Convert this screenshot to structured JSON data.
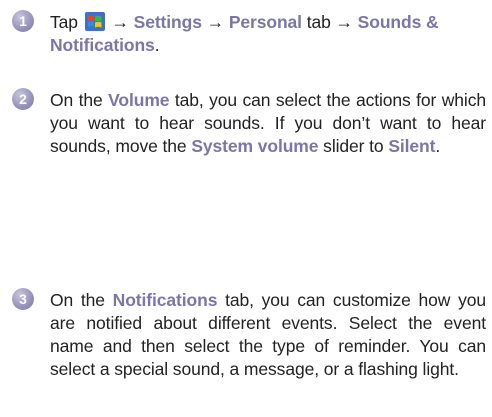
{
  "steps": [
    {
      "number": "1",
      "prefix": "Tap",
      "arrow1": " → ",
      "kw1": "Settings",
      "arrow2": " → ",
      "kw2": "Personal",
      "mid": " tab → ",
      "kw3": "Sounds & Notifications",
      "suffix": "."
    },
    {
      "number": "2",
      "t1": "On the ",
      "kw1": "Volume",
      "t2": " tab, you can select the actions for which you want to hear sounds. If you don’t want to hear sounds, move the ",
      "kw2": "System volume",
      "t3": " slider to ",
      "kw3": "Silent",
      "t4": "."
    },
    {
      "number": "3",
      "t1": "On the ",
      "kw1": "Notifications",
      "t2": " tab, you can customize how you are notified about different events. Select the event name and then select the type of reminder. You can select a special sound, a message, or a flashing light."
    }
  ],
  "icons": {
    "start": "windows-start-flag-icon"
  }
}
